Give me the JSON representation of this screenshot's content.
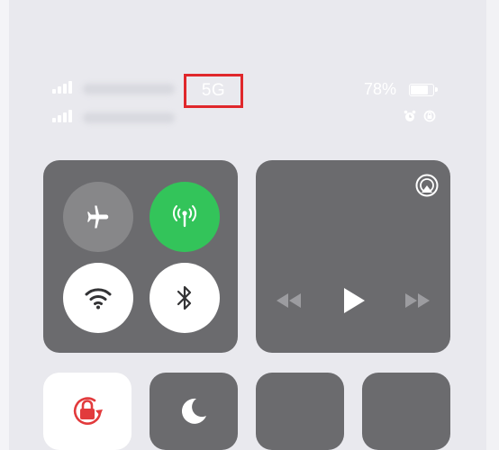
{
  "status_bar": {
    "network_type": "5G",
    "battery_percent": "78%",
    "battery_level": 0.78,
    "highlight_color": "#e0272b",
    "secondary_icons": [
      "alarm-icon",
      "orientation-lock-small-icon"
    ]
  },
  "control_center": {
    "connectivity": {
      "airplane_mode": false,
      "cellular_data": true,
      "wifi": true,
      "bluetooth": true,
      "active_color": "#33c45a"
    },
    "media": {
      "controls": [
        "rewind-icon",
        "play-icon",
        "fast-forward-icon"
      ],
      "airplay": "airplay-icon"
    },
    "bottom_row": [
      "screen-rotation-lock",
      "do-not-disturb",
      "control-tile",
      "control-tile"
    ]
  }
}
